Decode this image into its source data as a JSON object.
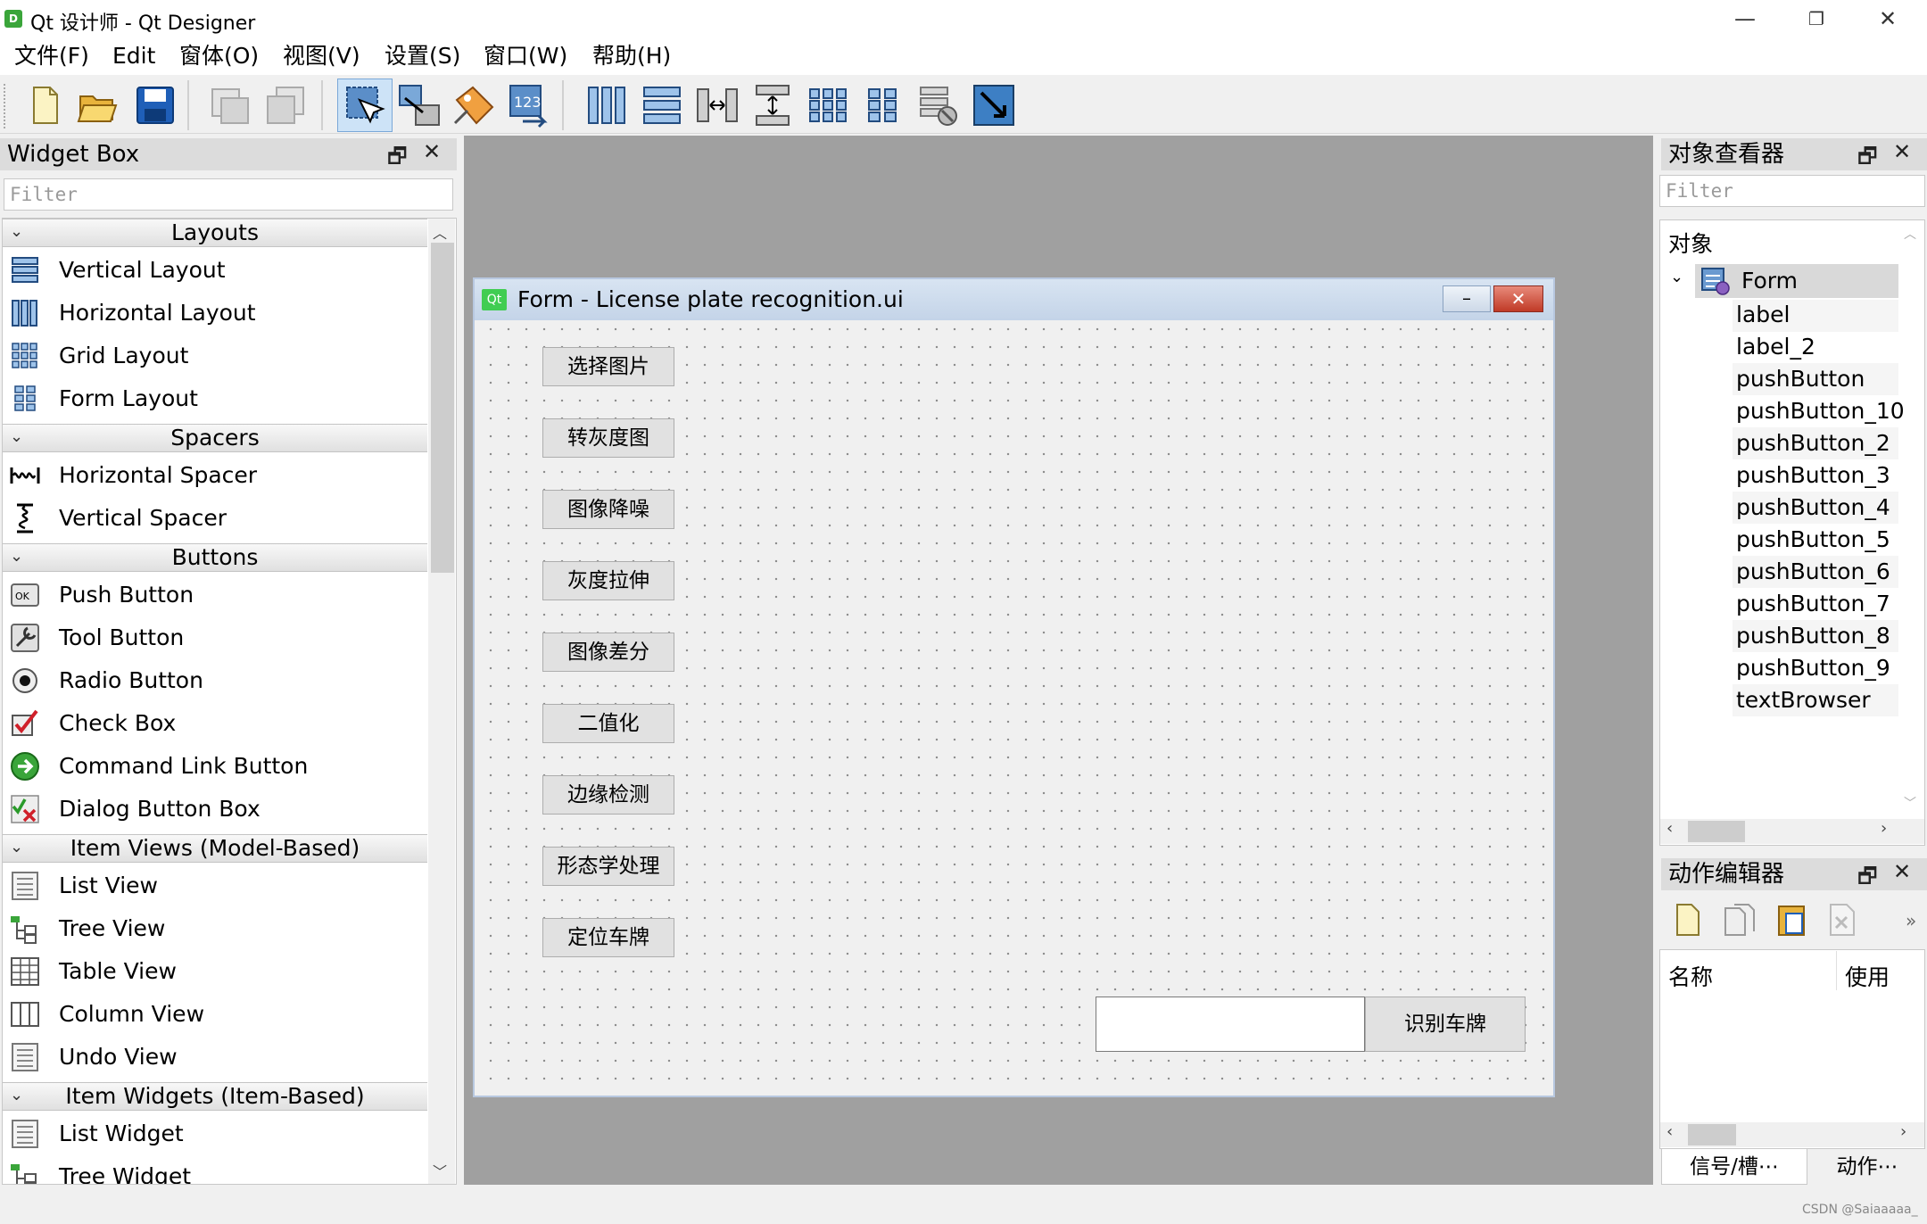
{
  "window": {
    "title": "Qt 设计师 - Qt Designer",
    "app_icon": "designer-icon",
    "minimize": "—",
    "restore": "❐",
    "close": "✕"
  },
  "menu": [
    "文件(F)",
    "Edit",
    "窗体(O)",
    "视图(V)",
    "设置(S)",
    "窗口(W)",
    "帮助(H)"
  ],
  "widget_box": {
    "title": "Widget Box",
    "filter_placeholder": "Filter",
    "categories": {
      "layouts": "Layouts",
      "spacers": "Spacers",
      "buttons": "Buttons",
      "item_views": "Item Views (Model-Based)",
      "item_widgets": "Item Widgets (Item-Based)"
    },
    "items": {
      "vertical_layout": "Vertical Layout",
      "horizontal_layout": "Horizontal Layout",
      "grid_layout": "Grid Layout",
      "form_layout": "Form Layout",
      "horizontal_spacer": "Horizontal Spacer",
      "vertical_spacer": "Vertical Spacer",
      "push_button": "Push Button",
      "tool_button": "Tool Button",
      "radio_button": "Radio Button",
      "check_box": "Check Box",
      "command_link_button": "Command Link Button",
      "dialog_button_box": "Dialog Button Box",
      "list_view": "List View",
      "tree_view": "Tree View",
      "table_view": "Table View",
      "column_view": "Column View",
      "undo_view": "Undo View",
      "list_widget": "List Widget",
      "tree_widget": "Tree Widget"
    }
  },
  "form": {
    "title_icon": "Qt",
    "title": "Form - License plate recognition.ui",
    "buttons": [
      "选择图片",
      "转灰度图",
      "图像降噪",
      "灰度拉伸",
      "图像差分",
      "二值化",
      "边缘检测",
      "形态学处理",
      "定位车牌"
    ],
    "recognize_button": "识别车牌",
    "result_field": ""
  },
  "object_inspector": {
    "title": "对象查看器",
    "filter_placeholder": "Filter",
    "header": "对象",
    "root": "Form",
    "children": [
      "label",
      "label_2",
      "pushButton",
      "pushButton_10",
      "pushButton_2",
      "pushButton_3",
      "pushButton_4",
      "pushButton_5",
      "pushButton_6",
      "pushButton_7",
      "pushButton_8",
      "pushButton_9",
      "textBrowser"
    ]
  },
  "action_editor": {
    "title": "动作编辑器",
    "col_name": "名称",
    "col_used": "使用",
    "tabs": [
      "信号/槽⋯",
      "动作⋯"
    ]
  },
  "watermark": "CSDN @Saiaaaaa_"
}
